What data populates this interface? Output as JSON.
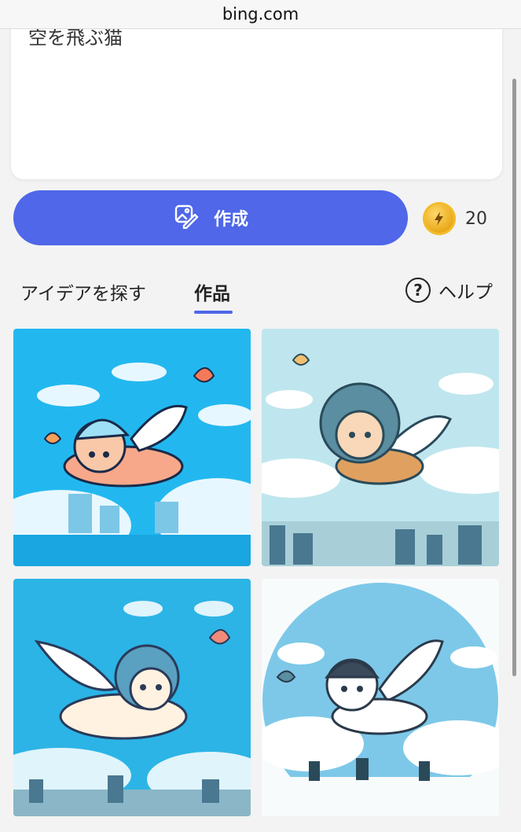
{
  "browser": {
    "url": "bing.com"
  },
  "prompt": {
    "text": "空を飛ぶ猫"
  },
  "create_button": {
    "label": "作成"
  },
  "boosts": {
    "count": "20"
  },
  "tabs": [
    {
      "label": "アイデアを探す"
    },
    {
      "label": "作品",
      "selected": true
    }
  ],
  "help": {
    "label": "ヘルプ"
  },
  "colors": {
    "accent": "#4f67e8",
    "coin": "#e6a412"
  },
  "results": [
    {
      "icon": "flying-cat-image-1"
    },
    {
      "icon": "flying-cat-image-2"
    },
    {
      "icon": "flying-cat-image-3"
    },
    {
      "icon": "flying-cat-image-4"
    }
  ]
}
